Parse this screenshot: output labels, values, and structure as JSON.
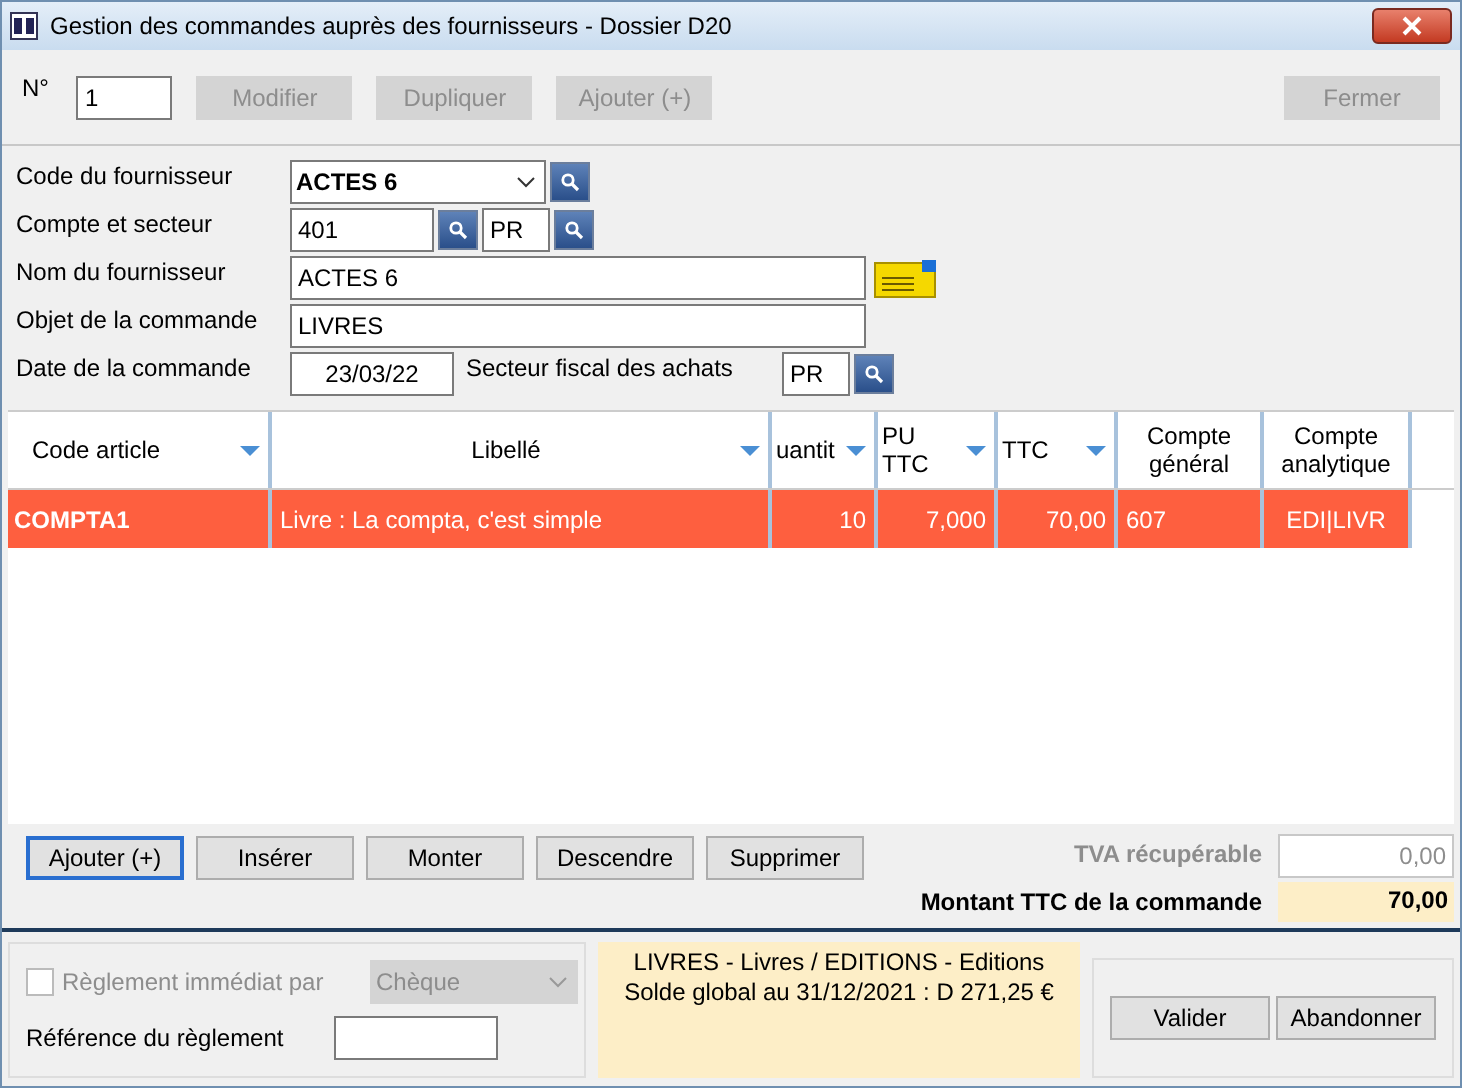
{
  "window": {
    "title": "Gestion des commandes auprès des fournisseurs - Dossier D20"
  },
  "toolbar": {
    "number_label": "N°",
    "number_value": "1",
    "buttons": [
      {
        "label": "Modifier",
        "disabled": true
      },
      {
        "label": "Dupliquer",
        "disabled": true
      },
      {
        "label": "Ajouter (+)",
        "disabled": true
      }
    ],
    "close": {
      "label": "Fermer",
      "disabled": true
    }
  },
  "form": {
    "supplier_code": {
      "label": "Code du fournisseur",
      "value": "ACTES 6"
    },
    "account": {
      "label": "Compte et secteur",
      "value": "401",
      "sector": "PR"
    },
    "supplier_name": {
      "label": "Nom du fournisseur",
      "value": "ACTES 6"
    },
    "subject": {
      "label": "Objet de la commande",
      "value": "LIVRES"
    },
    "date": {
      "label": "Date de la commande",
      "value": "23/03/22",
      "fiscal_label": "Secteur fiscal des achats",
      "fiscal_value": "PR"
    }
  },
  "grid": {
    "columns": [
      {
        "label": "Code article",
        "sortable": true
      },
      {
        "label": "Libellé",
        "sortable": true
      },
      {
        "label": "uantit",
        "sortable": true
      },
      {
        "label": "PU TTC",
        "sortable": true
      },
      {
        "label": "TTC",
        "sortable": true
      },
      {
        "label": "Compte général",
        "sortable": false
      },
      {
        "label": "Compte analytique",
        "sortable": false
      }
    ],
    "rows": [
      {
        "selected": true,
        "cells": [
          "COMPTA1",
          "Livre : La compta, c'est simple",
          "10",
          "7,000",
          "70,00",
          "607",
          "EDI|LIVR"
        ]
      }
    ]
  },
  "actions": [
    {
      "label": "Ajouter (+)",
      "focused": true
    },
    {
      "label": "Insérer",
      "focused": false
    },
    {
      "label": "Monter",
      "focused": false
    },
    {
      "label": "Descendre",
      "focused": false
    },
    {
      "label": "Supprimer",
      "focused": false
    }
  ],
  "totals": {
    "vat": {
      "label": "TVA récupérable",
      "value": "0,00",
      "disabled": true
    },
    "total": {
      "label": "Montant TTC de la commande",
      "value": "70,00"
    }
  },
  "payment": {
    "immediate_label": "Règlement immédiat par",
    "checked": false,
    "disabled": true,
    "method": "Chèque",
    "reference_label": "Référence du règlement"
  },
  "info": {
    "lines": [
      "LIVRES - Livres / EDITIONS - Editions",
      "Solde global au 31/12/2021 : D 271,25 €"
    ]
  },
  "dialog_buttons": [
    "Valider",
    "Abandonner"
  ]
}
